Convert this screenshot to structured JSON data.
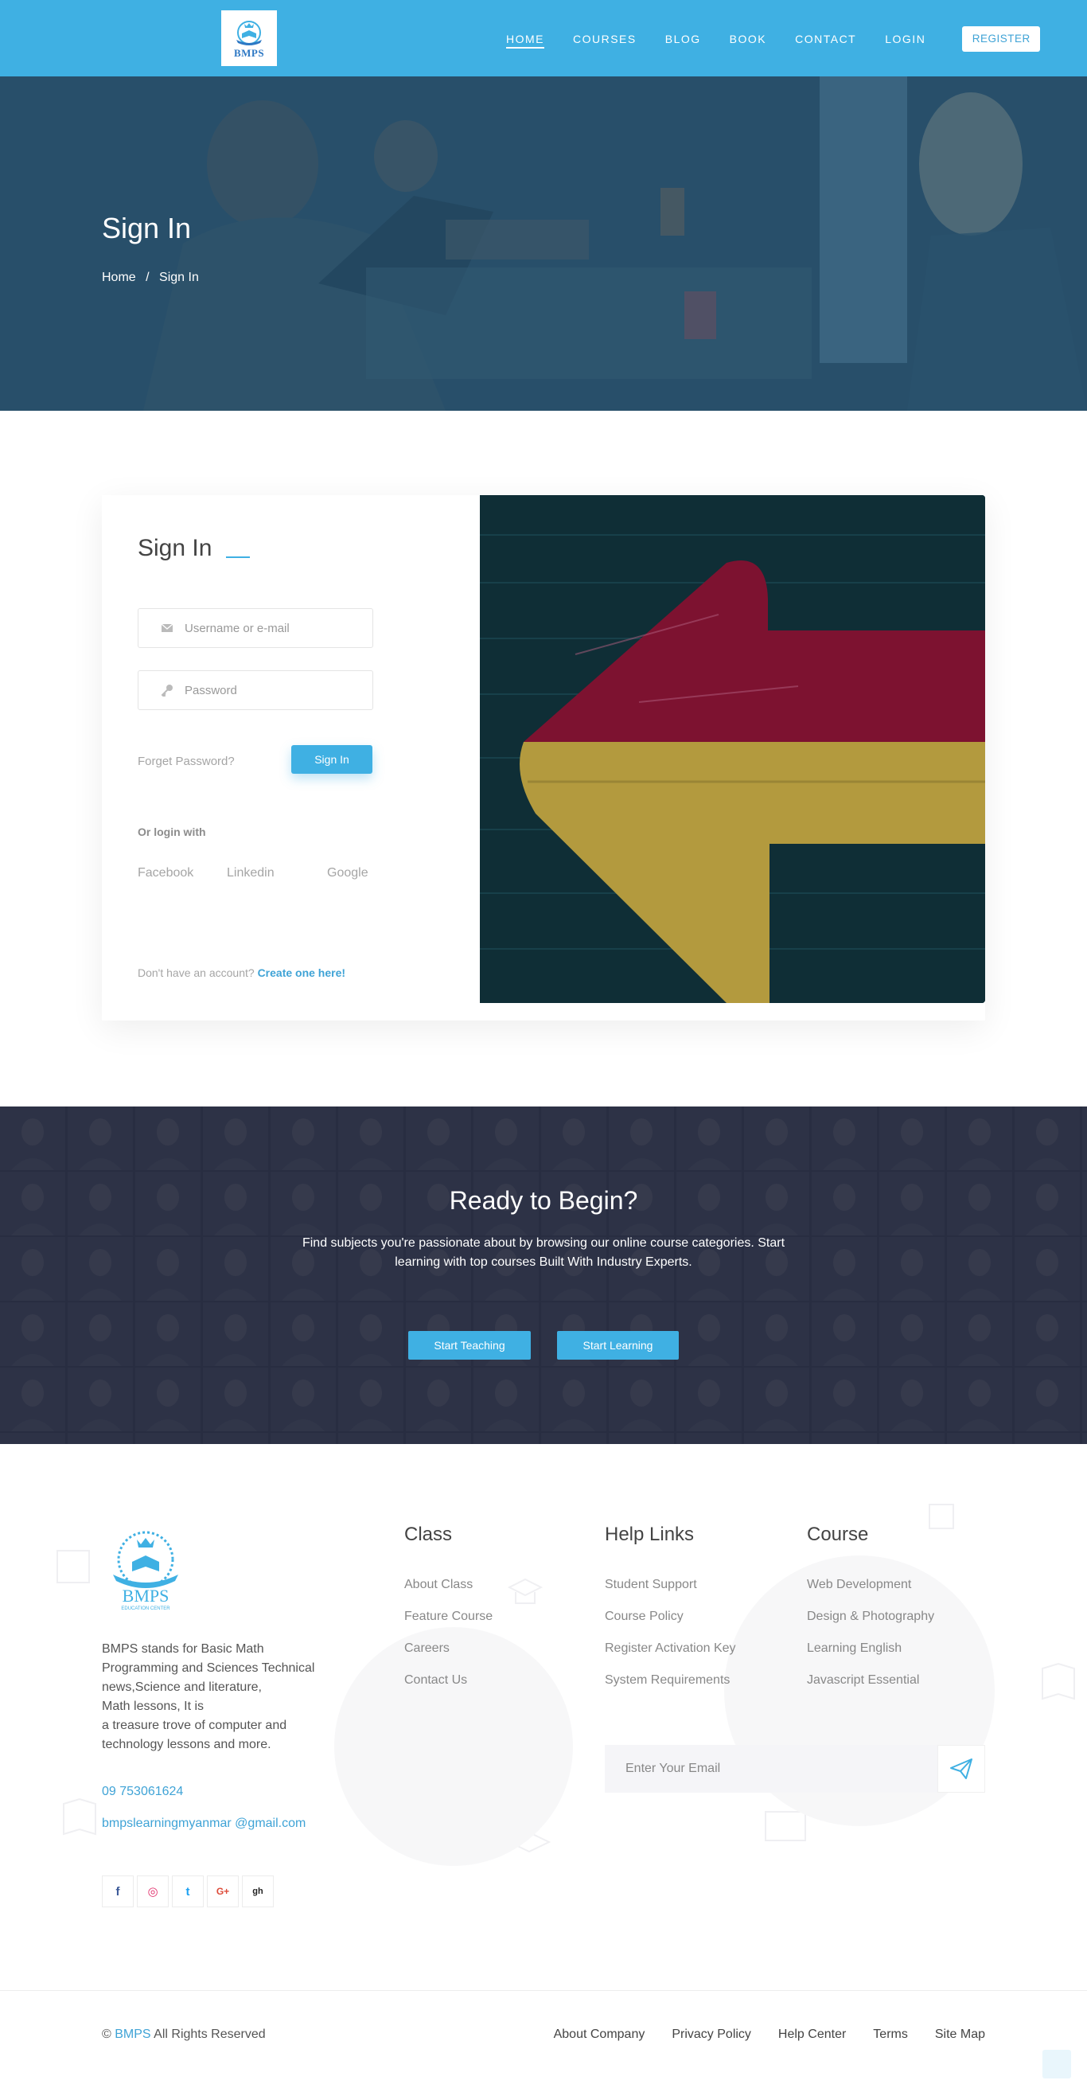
{
  "header": {
    "logo_text": "BMPS",
    "nav": [
      "HOME",
      "COURSES",
      "BLOG",
      "BOOK",
      "CONTACT",
      "LOGIN"
    ],
    "register": "REGISTER",
    "accent": "#3fb0e3"
  },
  "hero": {
    "title": "Sign In",
    "breadcrumb": {
      "home": "Home",
      "sep": "/",
      "current": "Sign In"
    }
  },
  "signin": {
    "title": "Sign In",
    "username_placeholder": "Username or e-mail",
    "password_placeholder": "Password",
    "forget": "Forget Password?",
    "button": "Sign In",
    "or_login": "Or login with",
    "social": [
      "Facebook",
      "Linkedin",
      "Google"
    ],
    "signup_prompt": "Don't have an account?",
    "signup_link": "Create one here!"
  },
  "cta": {
    "title": "Ready to Begin?",
    "text": "Find subjects you're passionate about by browsing our online course categories. Start learning with top courses Built With Industry Experts.",
    "teach": "Start Teaching",
    "learn": "Start Learning"
  },
  "footer": {
    "logo_text": "BMPS",
    "logo_sub": "EDUCATION CENTER",
    "about_lines": [
      "BMPS stands for Basic Math",
      "Programming and Sciences Technical",
      "news,Science and literature,",
      "Math lessons, It is",
      "a treasure trove of computer and",
      "technology lessons and more."
    ],
    "phone": "09 753061624",
    "email": "bmpslearningmyanmar @gmail.com",
    "socials": [
      "f",
      "◎",
      "t",
      "G+",
      "gh"
    ],
    "columns": [
      {
        "title": "Class",
        "items": [
          "About Class",
          "Feature Course",
          "Careers",
          "Contact Us"
        ]
      },
      {
        "title": "Help Links",
        "items": [
          "Student Support",
          "Course Policy",
          "Register Activation Key",
          "System Requirements"
        ]
      },
      {
        "title": "Course",
        "items": [
          "Web Development",
          "Design & Photography",
          "Learning English",
          "Javascript Essential"
        ]
      }
    ],
    "subscribe_placeholder": "Enter Your Email"
  },
  "bottom": {
    "copy_prefix": "©",
    "copy_brand": "BMPS",
    "copy_suffix": "All Rights Reserved",
    "links": [
      "About Company",
      "Privacy Policy",
      "Help Center",
      "Terms",
      "Site Map"
    ]
  }
}
